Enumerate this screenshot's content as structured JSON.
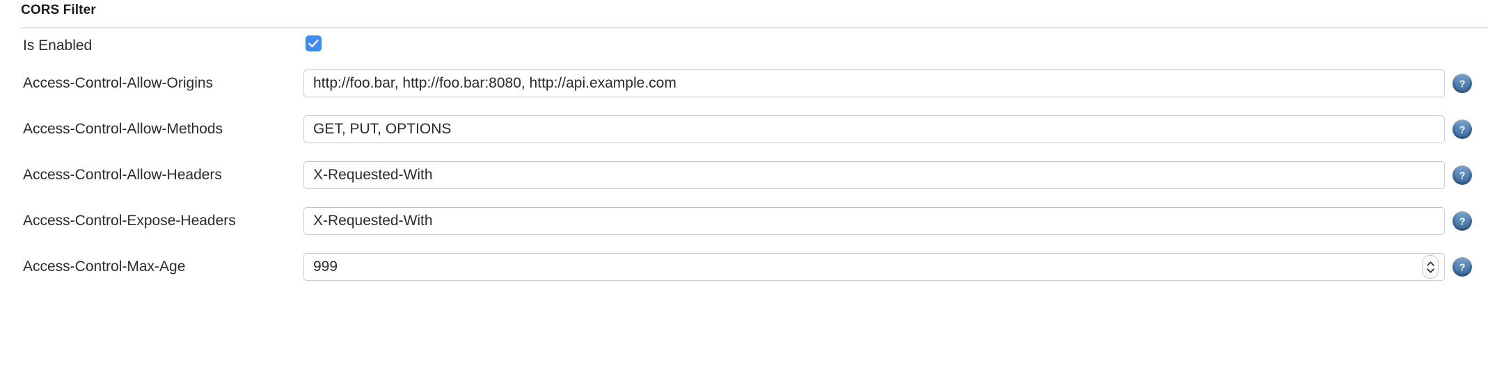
{
  "section": {
    "title": "CORS Filter"
  },
  "form": {
    "enabled_row": {
      "label": "Is Enabled",
      "checked": true
    },
    "fields": [
      {
        "label": "Access-Control-Allow-Origins",
        "value": "http://foo.bar, http://foo.bar:8080, http://api.example.com",
        "type": "text",
        "help_icon": "help-circle-icon"
      },
      {
        "label": "Access-Control-Allow-Methods",
        "value": "GET, PUT, OPTIONS",
        "type": "text",
        "help_icon": "help-circle-icon"
      },
      {
        "label": "Access-Control-Allow-Headers",
        "value": "X-Requested-With",
        "type": "text",
        "help_icon": "help-circle-icon"
      },
      {
        "label": "Access-Control-Expose-Headers",
        "value": "X-Requested-With",
        "type": "text",
        "help_icon": "help-circle-icon"
      },
      {
        "label": "Access-Control-Max-Age",
        "value": "999",
        "type": "number",
        "help_icon": "help-circle-icon",
        "stepper": {
          "up_icon": "chevron-up-icon",
          "down_icon": "chevron-down-icon"
        }
      }
    ]
  },
  "colors": {
    "checkbox_blue": "#3b8cf5",
    "help_icon_blue": "#3f6d9e",
    "divider": "#e2e2e2",
    "field_border": "#cfcfcf",
    "text": "#2b2b2b"
  }
}
